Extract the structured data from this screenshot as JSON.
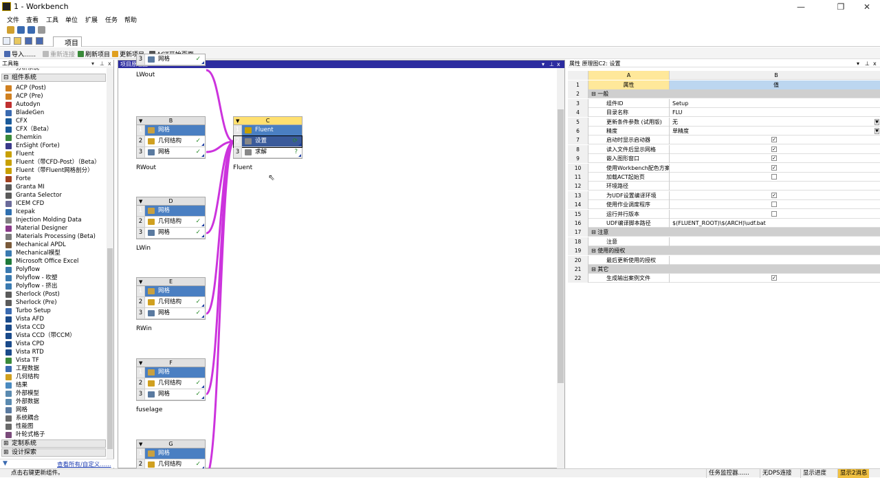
{
  "window": {
    "title": "1 - Workbench",
    "min": "—",
    "max": "❐",
    "close": "✕"
  },
  "menu": [
    "文件",
    "查看",
    "工具",
    "单位",
    "扩展",
    "任务",
    "帮助"
  ],
  "tabs": {
    "project": "项目"
  },
  "toolbar": {
    "import": "导入......",
    "reconnect": "重新连接",
    "refresh": "刷新项目",
    "update": "更新项目",
    "act": "ACT开始页面"
  },
  "toolbox": {
    "title": "工具箱",
    "partial_top": "分析系统",
    "group_component": "组件系统",
    "items": [
      {
        "label": "ACP (Post)",
        "color": "#d08020"
      },
      {
        "label": "ACP (Pre)",
        "color": "#d08020"
      },
      {
        "label": "Autodyn",
        "color": "#c03030"
      },
      {
        "label": "BladeGen",
        "color": "#3a6ab0"
      },
      {
        "label": "CFX",
        "color": "#1a5a9a"
      },
      {
        "label": "CFX（Beta）",
        "color": "#1a5a9a"
      },
      {
        "label": "Chemkin",
        "color": "#3a8a3a"
      },
      {
        "label": "EnSight (Forte)",
        "color": "#3a3a8a"
      },
      {
        "label": "Fluent",
        "color": "#c8a000"
      },
      {
        "label": "Fluent（带CFD-Post）（Beta）",
        "color": "#c8a000"
      },
      {
        "label": "Fluent（带Fluent网格剖分）",
        "color": "#c8a000"
      },
      {
        "label": "Forte",
        "color": "#a04020"
      },
      {
        "label": "Granta MI",
        "color": "#5a5a5a"
      },
      {
        "label": "Granta Selector",
        "color": "#5a5a5a"
      },
      {
        "label": "ICEM CFD",
        "color": "#6a6a9a"
      },
      {
        "label": "Icepak",
        "color": "#3070b0"
      },
      {
        "label": "Injection Molding Data",
        "color": "#808080"
      },
      {
        "label": "Material Designer",
        "color": "#8a3a8a"
      },
      {
        "label": "Materials Processing (Beta)",
        "color": "#7a7a7a"
      },
      {
        "label": "Mechanical APDL",
        "color": "#7a5a3a"
      },
      {
        "label": "Mechanical模型",
        "color": "#3a7ab0"
      },
      {
        "label": "Microsoft Office Excel",
        "color": "#1e7a3a"
      },
      {
        "label": "Polyflow",
        "color": "#3a7ab0"
      },
      {
        "label": "Polyflow - 吹塑",
        "color": "#3a7ab0"
      },
      {
        "label": "Polyflow - 挤出",
        "color": "#3a7ab0"
      },
      {
        "label": "Sherlock (Post)",
        "color": "#5a5a5a"
      },
      {
        "label": "Sherlock (Pre)",
        "color": "#5a5a5a"
      },
      {
        "label": "Turbo Setup",
        "color": "#3a6ab0"
      },
      {
        "label": "Vista AFD",
        "color": "#1a4a8a"
      },
      {
        "label": "Vista CCD",
        "color": "#1a4a8a"
      },
      {
        "label": "Vista CCD（带CCM）",
        "color": "#1a4a8a"
      },
      {
        "label": "Vista CPD",
        "color": "#1a4a8a"
      },
      {
        "label": "Vista RTD",
        "color": "#1a4a8a"
      },
      {
        "label": "Vista TF",
        "color": "#3a8a3a"
      },
      {
        "label": "工程数据",
        "color": "#3a6ab0"
      },
      {
        "label": "几何结构",
        "color": "#d0a020"
      },
      {
        "label": "结果",
        "color": "#4a8ac0"
      },
      {
        "label": "外部模型",
        "color": "#5a8ab0"
      },
      {
        "label": "外部数据",
        "color": "#5a8ab0"
      },
      {
        "label": "网格",
        "color": "#5a7aa0"
      },
      {
        "label": "系统耦合",
        "color": "#6a6a6a"
      },
      {
        "label": "性能图",
        "color": "#6a6a6a"
      },
      {
        "label": "叶轮式格子",
        "color": "#7a4a7a"
      }
    ],
    "group_custom": "定制系统",
    "group_design": "设计探索",
    "footer_link": "查看所有/自定义......"
  },
  "schematic": {
    "title": "项目原理图",
    "systems": [
      {
        "id": "A",
        "rows": [
          {
            "n": "3",
            "label": "网格",
            "status": "✓",
            "icon": "#5a7aa0"
          }
        ],
        "caption": "LWout"
      },
      {
        "id": "B",
        "rows": [
          {
            "n": "1",
            "label": "网格",
            "status": "",
            "icon": "#c8a040"
          },
          {
            "n": "2",
            "label": "几何结构",
            "status": "✓",
            "icon": "#d0a020"
          },
          {
            "n": "3",
            "label": "网格",
            "status": "✓",
            "icon": "#5a7aa0"
          }
        ],
        "caption": "RWout"
      },
      {
        "id": "C",
        "rows": [
          {
            "n": "1",
            "label": "Fluent",
            "status": "",
            "icon": "#c8a000"
          },
          {
            "n": "2",
            "label": "设置",
            "status": "⟳",
            "icon": "#888888"
          },
          {
            "n": "3",
            "label": "求解",
            "status": "?",
            "icon": "#888888"
          }
        ],
        "caption": "Fluent"
      },
      {
        "id": "D",
        "rows": [
          {
            "n": "1",
            "label": "网格",
            "status": "",
            "icon": "#c8a040"
          },
          {
            "n": "2",
            "label": "几何结构",
            "status": "✓",
            "icon": "#d0a020"
          },
          {
            "n": "3",
            "label": "网格",
            "status": "✓",
            "icon": "#5a7aa0"
          }
        ],
        "caption": "LWin"
      },
      {
        "id": "E",
        "rows": [
          {
            "n": "1",
            "label": "网格",
            "status": "",
            "icon": "#c8a040"
          },
          {
            "n": "2",
            "label": "几何结构",
            "status": "✓",
            "icon": "#d0a020"
          },
          {
            "n": "3",
            "label": "网格",
            "status": "✓",
            "icon": "#5a7aa0"
          }
        ],
        "caption": "RWin"
      },
      {
        "id": "F",
        "rows": [
          {
            "n": "1",
            "label": "网格",
            "status": "",
            "icon": "#c8a040"
          },
          {
            "n": "2",
            "label": "几何结构",
            "status": "✓",
            "icon": "#d0a020"
          },
          {
            "n": "3",
            "label": "网格",
            "status": "✓",
            "icon": "#5a7aa0"
          }
        ],
        "caption": "fuselage"
      },
      {
        "id": "G",
        "rows": [
          {
            "n": "1",
            "label": "网格",
            "status": "",
            "icon": "#c8a040"
          },
          {
            "n": "2",
            "label": "几何结构",
            "status": "✓",
            "icon": "#d0a020"
          }
        ],
        "caption": ""
      }
    ]
  },
  "properties": {
    "title": "属性 原理图C2: 设置",
    "col_a": "A",
    "col_b": "B",
    "rows": [
      {
        "n": "1",
        "type": "header",
        "a": "属性",
        "b": "值"
      },
      {
        "n": "2",
        "type": "cat",
        "a": "一般"
      },
      {
        "n": "3",
        "a": "组件ID",
        "b": "Setup"
      },
      {
        "n": "4",
        "a": "目录名称",
        "b": "FLU"
      },
      {
        "n": "5",
        "a": "更新条件参数 (试用版)",
        "b": "无",
        "dropdown": true
      },
      {
        "n": "6",
        "a": "精度",
        "b": "单精度",
        "dropdown": true
      },
      {
        "n": "7",
        "a": "启动时显示启动器",
        "check": "✓"
      },
      {
        "n": "8",
        "a": "读入文件后显示网格",
        "check": "✓"
      },
      {
        "n": "9",
        "a": "嵌入图形窗口",
        "check": "✓"
      },
      {
        "n": "10",
        "a": "使用Workbench配色方案",
        "check": "✓"
      },
      {
        "n": "11",
        "a": "加载ACT起始页",
        "check": ""
      },
      {
        "n": "12",
        "a": "环境路径",
        "b": ""
      },
      {
        "n": "13",
        "a": "为UDF设置编译环境",
        "check": "✓"
      },
      {
        "n": "14",
        "a": "使用作业调度程序",
        "check": ""
      },
      {
        "n": "15",
        "a": "运行并行版本",
        "check": ""
      },
      {
        "n": "16",
        "a": "UDF编译脚本路径",
        "b": "$(FLUENT_ROOT)\\$(ARCH)\\udf.bat"
      },
      {
        "n": "17",
        "type": "cat",
        "a": "注意"
      },
      {
        "n": "18",
        "a": "注意",
        "b": ""
      },
      {
        "n": "19",
        "type": "cat",
        "a": "使用的授权"
      },
      {
        "n": "20",
        "a": "最后更新使用的授权",
        "b": ""
      },
      {
        "n": "21",
        "type": "cat",
        "a": "其它"
      },
      {
        "n": "22",
        "a": "生成输出案例文件",
        "check": "✓"
      }
    ]
  },
  "status": {
    "message": "点击右键更新组件。",
    "job_monitor": "任务监控器......",
    "dps": "无DPS连接",
    "progress": "显示进度",
    "messages": "显示2消息"
  }
}
